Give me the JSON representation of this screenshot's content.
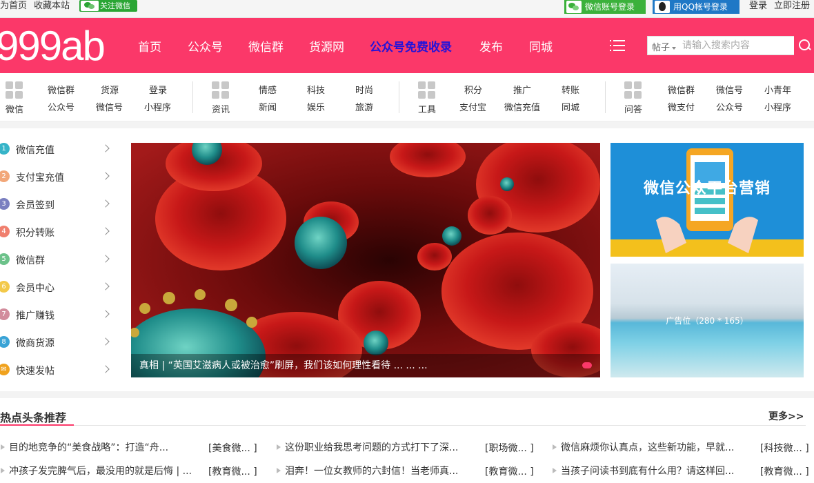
{
  "topbar": {
    "links": [
      "为首页",
      "收藏本站"
    ],
    "follow_wechat": "关注微信",
    "wechat_login": "微信账号登录",
    "qq_login": "用QQ帐号登录",
    "login": "登录",
    "register": "立即注册"
  },
  "header": {
    "logo": "999ab",
    "nav": [
      "首页",
      "公众号",
      "微信群",
      "货源网",
      "公众号免费收录",
      "发布",
      "同城"
    ],
    "search_category": "帖子",
    "search_placeholder": "请输入搜索内容"
  },
  "categories": [
    {
      "title": "微信",
      "links": [
        "微信群",
        "货源",
        "登录",
        "公众号",
        "微信号",
        "小程序"
      ]
    },
    {
      "title": "资讯",
      "links": [
        "情感",
        "科技",
        "时尚",
        "新闻",
        "娱乐",
        "旅游"
      ]
    },
    {
      "title": "工具",
      "links": [
        "积分",
        "推广",
        "转账",
        "支付宝",
        "微信充值",
        "同城"
      ]
    },
    {
      "title": "问答",
      "links": [
        "微信群",
        "微信号",
        "小青年",
        "微支付",
        "公众号",
        "小程序"
      ]
    }
  ],
  "sidebar": [
    {
      "num": "1",
      "label": "微信充值",
      "color": "#36b4c8"
    },
    {
      "num": "2",
      "label": "支付宝充值",
      "color": "#f2a779"
    },
    {
      "num": "3",
      "label": "会员签到",
      "color": "#7a7fc0"
    },
    {
      "num": "4",
      "label": "积分转账",
      "color": "#f07f6e"
    },
    {
      "num": "5",
      "label": "微信群",
      "color": "#6cc28a"
    },
    {
      "num": "6",
      "label": "会员中心",
      "color": "#f3c94a"
    },
    {
      "num": "7",
      "label": "推广赚钱",
      "color": "#d28c9c"
    },
    {
      "num": "8",
      "label": "微商货源",
      "color": "#39a3d6"
    },
    {
      "num": "✉",
      "label": "快速发帖",
      "color": "#f0a21e"
    }
  ],
  "banner": {
    "caption": "真相 | “英国艾滋病人或被治愈”刷屏，我们该如何理性看待 ... ... ..."
  },
  "ads": {
    "ad1_text": "微信公众平台营销",
    "ad2_text": "广告位（280 * 165）"
  },
  "hot": {
    "title": "热点头条推荐",
    "more": "更多>>",
    "rows": [
      [
        {
          "title": "目的地竞争的“美食战略”：打造“舟...",
          "tag": "[美食微... ]"
        },
        {
          "title": "这份职业给我思考问题的方式打下了深...",
          "tag": "[职场微... ]"
        },
        {
          "title": "微信麻烦你认真点，这些新功能，早就...",
          "tag": "[科技微... ]"
        }
      ],
      [
        {
          "title": "冲孩子发完脾气后，最没用的就是后悔 | ...",
          "tag": "[教育微... ]"
        },
        {
          "title": "泪奔！一位女教师的六封信！当老师真...",
          "tag": "[教育微... ]"
        },
        {
          "title": "当孩子问读书到底有什么用？请这样回...",
          "tag": "[教育微... ]"
        }
      ]
    ]
  }
}
